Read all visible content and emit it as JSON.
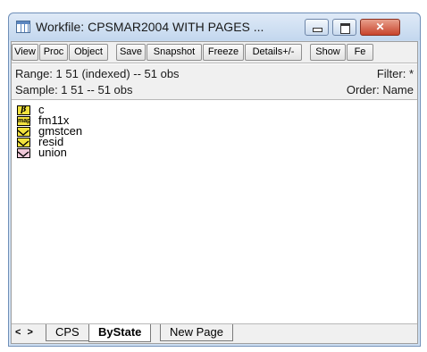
{
  "window": {
    "title": "Workfile: CPSMAR2004 WITH PAGES ...",
    "icon": "workfile-icon"
  },
  "toolbar": {
    "buttons": [
      "View",
      "Proc",
      "Object",
      "Save",
      "Snapshot",
      "Freeze",
      "Details+/-",
      "Show",
      "Fe"
    ]
  },
  "info": {
    "range": "Range:  1 51 (indexed)  --  51 obs",
    "sample": "Sample: 1 51  --  51 obs",
    "filter": "Filter: *",
    "order": "Order: Name"
  },
  "objects": [
    {
      "name": "c",
      "icon": "coef-icon"
    },
    {
      "name": "fm11x",
      "icon": "map-icon"
    },
    {
      "name": "gmstcen",
      "icon": "series-icon"
    },
    {
      "name": "resid",
      "icon": "series-icon"
    },
    {
      "name": "union",
      "icon": "series-icon"
    }
  ],
  "tabs": {
    "nav": "< >",
    "items": [
      "CPS",
      "ByState",
      "New Page"
    ],
    "active": "ByState"
  }
}
